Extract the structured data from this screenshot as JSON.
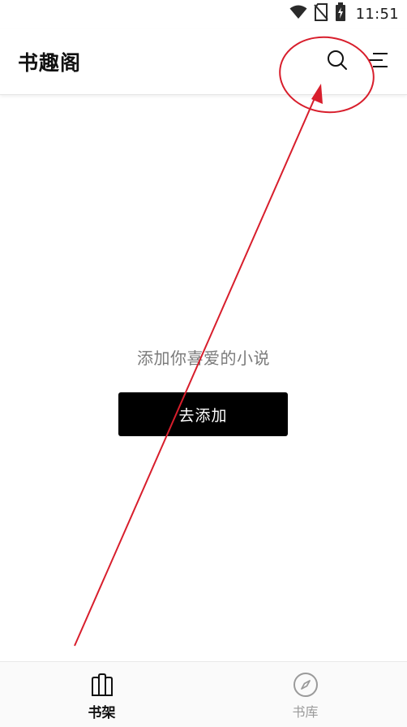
{
  "status_bar": {
    "time": "11:51",
    "icons": [
      "wifi-icon",
      "no-sim-icon",
      "battery-charging-icon"
    ]
  },
  "header": {
    "title": "书趣阁",
    "search_icon": "search-icon",
    "menu_icon": "menu-icon"
  },
  "empty_state": {
    "message": "添加你喜爱的小说",
    "button_label": "去添加"
  },
  "bottom_nav": {
    "items": [
      {
        "label": "书架",
        "icon": "bookshelf-icon",
        "active": true
      },
      {
        "label": "书库",
        "icon": "compass-icon",
        "active": false
      }
    ]
  },
  "colors": {
    "primary": "#000000",
    "text_muted": "#7a7a7a",
    "annotation": "#d81e2c",
    "inactive_nav": "#9a9a9a"
  }
}
